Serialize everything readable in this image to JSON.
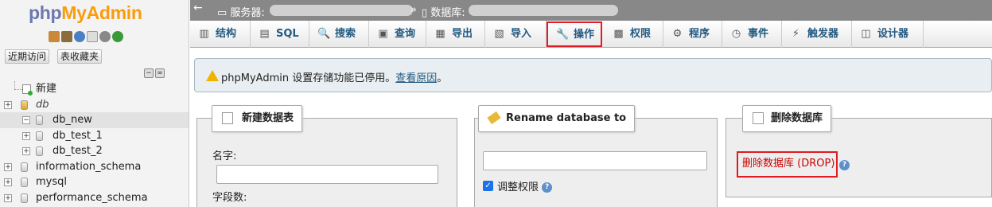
{
  "app": {
    "logo_a": "php",
    "logo_b": "MyAdmin"
  },
  "sidebar": {
    "quick_icons": [
      "home-icon",
      "database-icon",
      "help-icon",
      "docs-icon",
      "settings-icon",
      "reload-icon"
    ],
    "tab_recent": "近期访问",
    "tab_favorites": "表收藏夹",
    "collapse": "−",
    "link": "∞",
    "tree": [
      {
        "label": "新建",
        "type": "new"
      },
      {
        "label": "db",
        "type": "db",
        "italic": true
      },
      {
        "label": "db_new",
        "type": "db",
        "selected": true
      },
      {
        "label": "db_test_1",
        "type": "db"
      },
      {
        "label": "db_test_2",
        "type": "db"
      },
      {
        "label": "information_schema",
        "type": "db"
      },
      {
        "label": "mysql",
        "type": "db"
      },
      {
        "label": "performance_schema",
        "type": "db"
      }
    ]
  },
  "breadcrumb": {
    "back": "←",
    "server_label": "服务器:",
    "sep": "»",
    "db_label": "数据库:"
  },
  "tabs": [
    {
      "label": "结构",
      "icon": "structure-icon",
      "glyph": "▥"
    },
    {
      "label": "SQL",
      "icon": "sql-icon",
      "glyph": "▤"
    },
    {
      "label": "搜索",
      "icon": "search-icon",
      "glyph": "🔍"
    },
    {
      "label": "查询",
      "icon": "query-icon",
      "glyph": "▣"
    },
    {
      "label": "导出",
      "icon": "export-icon",
      "glyph": "▦"
    },
    {
      "label": "导入",
      "icon": "import-icon",
      "glyph": "▧"
    },
    {
      "label": "操作",
      "icon": "wrench-icon",
      "glyph": "🔧",
      "active": true
    },
    {
      "label": "权限",
      "icon": "privileges-icon",
      "glyph": "▩"
    },
    {
      "label": "程序",
      "icon": "routines-icon",
      "glyph": "⚙"
    },
    {
      "label": "事件",
      "icon": "events-icon",
      "glyph": "◷"
    },
    {
      "label": "触发器",
      "icon": "triggers-icon",
      "glyph": "⚡"
    },
    {
      "label": "设计器",
      "icon": "designer-icon",
      "glyph": "◫"
    }
  ],
  "notice": {
    "text": "phpMyAdmin 设置存储功能已停用。",
    "link": "查看原因",
    "end": "。"
  },
  "create_table": {
    "legend": "新建数据表",
    "name_label": "名字:",
    "name_value": "",
    "cols_label": "字段数:"
  },
  "rename": {
    "legend": "Rename database to",
    "value": "",
    "adjust_label": "调整权限",
    "check": "✓"
  },
  "drop": {
    "legend": "删除数据库",
    "link": "删除数据库 (DROP)"
  },
  "help_glyph": "?"
}
